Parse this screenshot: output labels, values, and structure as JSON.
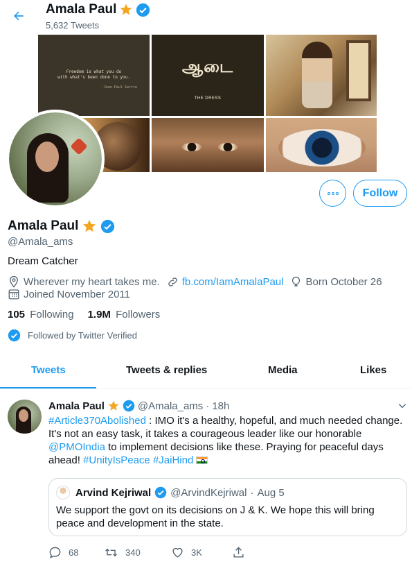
{
  "header": {
    "title": "Amala Paul",
    "tweet_count": "5,632 Tweets"
  },
  "banner": {
    "quote_line1": "Freedom is what you do",
    "quote_line2": "with what's been done to you.",
    "quote_author": "-Jean-Paul Sartre",
    "movie_title": "ஆடை",
    "movie_subtitle": "THE DRESS"
  },
  "actions": {
    "follow_label": "Follow"
  },
  "profile": {
    "name": "Amala Paul",
    "handle": "@Amala_ams",
    "bio": "Dream Catcher",
    "location": "Wherever my heart takes me.",
    "website": "fb.com/IamAmalaPaul",
    "birthday": "Born October 26",
    "joined": "Joined November 2011",
    "following_count": "105",
    "following_label": "Following",
    "followers_count": "1.9M",
    "followers_label": "Followers",
    "followed_by": "Followed by Twitter Verified"
  },
  "tabs": [
    {
      "label": "Tweets",
      "active": true
    },
    {
      "label": "Tweets & replies",
      "active": false
    },
    {
      "label": "Media",
      "active": false
    },
    {
      "label": "Likes",
      "active": false
    }
  ],
  "tweet": {
    "name": "Amala Paul",
    "handle": "@Amala_ams",
    "separator": "·",
    "time": "18h",
    "hashtag1": "#Article370Abolished",
    "text1": " : IMO it's a healthy, hopeful, and much needed change. It's not an easy task, it takes a courageous leader like our honorable ",
    "mention": "@PMOIndia",
    "text2": " to implement decisions like these. Praying for peaceful days ahead!  ",
    "hashtag2": "#UnityIsPeace",
    "hashtag3": "#JaiHind",
    "quote": {
      "name": "Arvind Kejriwal",
      "handle": "@ArvindKejriwal",
      "separator": "·",
      "date": "Aug 5",
      "text": "We support the govt on its decisions on J & K. We hope this will bring peace and development in the state."
    },
    "reply_count": "68",
    "retweet_count": "340",
    "like_count": "3K"
  },
  "colors": {
    "accent": "#1d9bf0",
    "verified": "#1d9bf0",
    "star": "#f4a623",
    "secondary_text": "#536471"
  }
}
